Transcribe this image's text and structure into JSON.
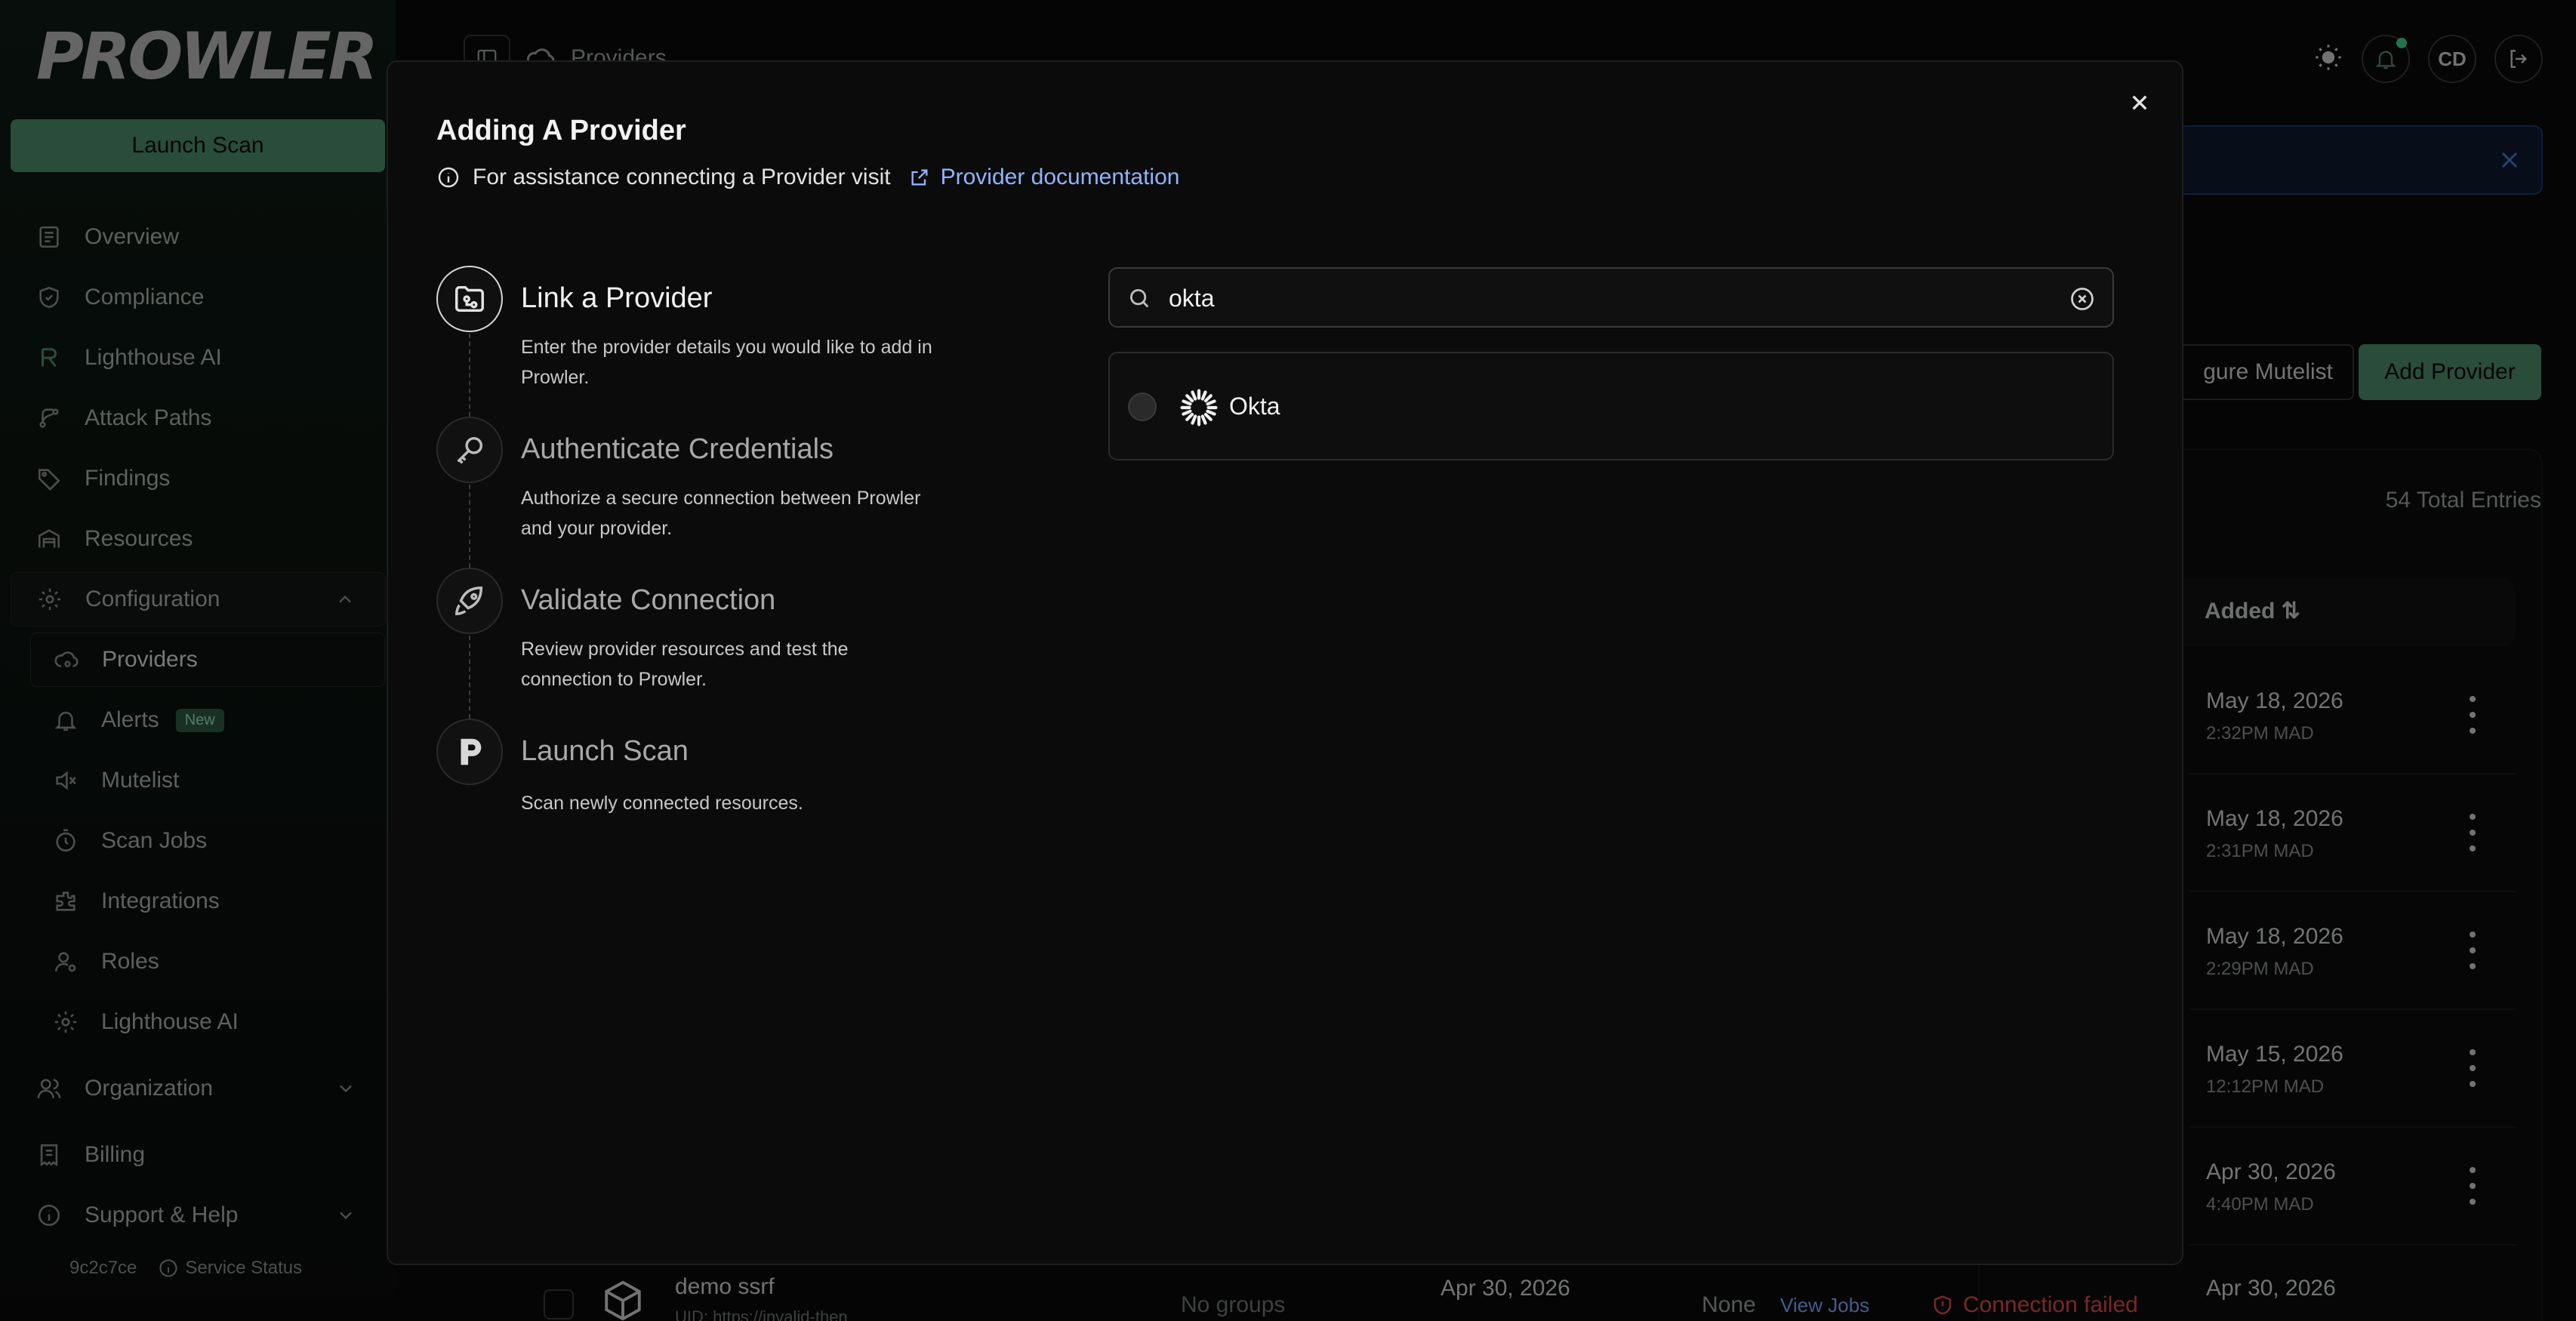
{
  "sidebar": {
    "logo": "PROWLER",
    "launch_scan": "Launch Scan",
    "items": [
      {
        "label": "Overview"
      },
      {
        "label": "Compliance"
      },
      {
        "label": "Lighthouse AI"
      },
      {
        "label": "Attack Paths"
      },
      {
        "label": "Findings"
      },
      {
        "label": "Resources"
      },
      {
        "label": "Configuration"
      }
    ],
    "config_items": [
      {
        "label": "Providers"
      },
      {
        "label": "Alerts",
        "badge": "New"
      },
      {
        "label": "Mutelist"
      },
      {
        "label": "Scan Jobs"
      },
      {
        "label": "Integrations"
      },
      {
        "label": "Roles"
      },
      {
        "label": "Lighthouse AI"
      }
    ],
    "organization": "Organization",
    "billing": "Billing",
    "support": "Support & Help",
    "version": "9c2c7ce",
    "service_status": "Service Status"
  },
  "header": {
    "breadcrumb": "Providers",
    "avatar_initials": "CD"
  },
  "page": {
    "configure_mutelist": "gure Mutelist",
    "add_provider": "Add Provider",
    "total_entries": "54 Total Entries",
    "added_header": "Added",
    "rows": [
      {
        "date": "May 18, 2026",
        "time": "2:32PM MAD"
      },
      {
        "date": "May 18, 2026",
        "time": "2:31PM MAD"
      },
      {
        "date": "May 18, 2026",
        "time": "2:29PM MAD"
      },
      {
        "date": "May 15, 2026",
        "time": "12:12PM MAD"
      },
      {
        "date": "Apr 30, 2026",
        "time": "4:40PM MAD"
      }
    ],
    "bottom_row": {
      "name": "demo ssrf",
      "uid": "UID:  https://invalid-then",
      "groups": "No groups",
      "date": "Apr 30, 2026",
      "none": "None",
      "view_jobs": "View Jobs",
      "status": "Connection failed",
      "added": "Apr 30, 2026"
    }
  },
  "modal": {
    "title": "Adding A Provider",
    "help_text": "For assistance connecting a Provider visit",
    "help_link": "Provider documentation",
    "steps": [
      {
        "title": "Link a Provider",
        "desc": "Enter the provider details you would like to add in Prowler."
      },
      {
        "title": "Authenticate Credentials",
        "desc": "Authorize a secure connection between Prowler and your provider."
      },
      {
        "title": "Validate Connection",
        "desc": "Review provider resources and test the connection to Prowler."
      },
      {
        "title": "Launch Scan",
        "desc": "Scan newly connected resources."
      }
    ],
    "search_value": "okta",
    "results": [
      {
        "label": "Okta"
      }
    ]
  },
  "colors": {
    "accent": "#4d8a6a",
    "link": "#8fb4ff",
    "error": "#e04848"
  }
}
